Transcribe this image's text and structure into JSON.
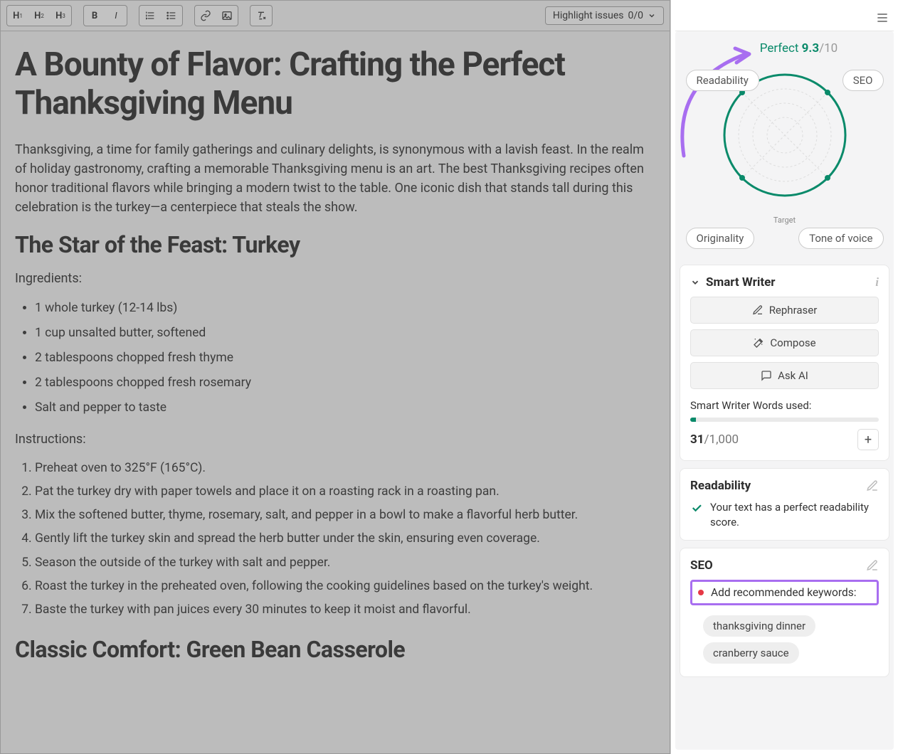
{
  "toolbar": {
    "h1": "H",
    "h1s": "1",
    "h2": "H",
    "h2s": "2",
    "h3": "H",
    "h3s": "3",
    "highlight_label": "Highlight issues",
    "issue_count": "0/0"
  },
  "doc": {
    "title": "A Bounty of Flavor: Crafting the Perfect Thanksgiving Menu",
    "intro": "Thanksgiving, a time for family gatherings and culinary delights, is synonymous with a lavish feast. In the realm of holiday gastronomy, crafting a memorable Thanksgiving menu is an art. The best Thanksgiving recipes often honor traditional flavors while bringing a modern twist to the table. One iconic dish that stands tall during this celebration is the turkey—a centerpiece that steals the show.",
    "h2a": "The Star of the Feast: Turkey",
    "ingredients_label": "Ingredients:",
    "ingredients": [
      "1 whole turkey (12-14 lbs)",
      "1 cup unsalted butter, softened",
      "2 tablespoons chopped fresh thyme",
      "2 tablespoons chopped fresh rosemary",
      "Salt and pepper to taste"
    ],
    "instructions_label": "Instructions:",
    "instructions": [
      "Preheat oven to 325°F (165°C).",
      "Pat the turkey dry with paper towels and place it on a roasting rack in a roasting pan.",
      "Mix the softened butter, thyme, rosemary, salt, and pepper in a bowl to make a flavorful herb butter.",
      "Gently lift the turkey skin and spread the herb butter under the skin, ensuring even coverage.",
      "Season the outside of the turkey with salt and pepper.",
      "Roast the turkey in the preheated oven, following the cooking guidelines based on the turkey's weight.",
      "Baste the turkey with pan juices every 30 minutes to keep it moist and flavorful."
    ],
    "h2b": "Classic Comfort: Green Bean Casserole"
  },
  "score": {
    "word": "Perfect",
    "value": "9.3",
    "denom": "/10",
    "pills": {
      "tl": "Readability",
      "tr": "SEO",
      "bl": "Originality",
      "br": "Tone of voice"
    },
    "target": "Target"
  },
  "smart_writer": {
    "title": "Smart Writer",
    "rephraser": "Rephraser",
    "compose": "Compose",
    "ask_ai": "Ask AI",
    "words_label": "Smart Writer Words used:",
    "used": "31",
    "limit": "/1,000"
  },
  "readability": {
    "title": "Readability",
    "msg": "Your text has a perfect readability score."
  },
  "seo": {
    "title": "SEO",
    "add_keywords": "Add recommended keywords:",
    "chips": [
      "thanksgiving dinner",
      "cranberry sauce"
    ]
  }
}
